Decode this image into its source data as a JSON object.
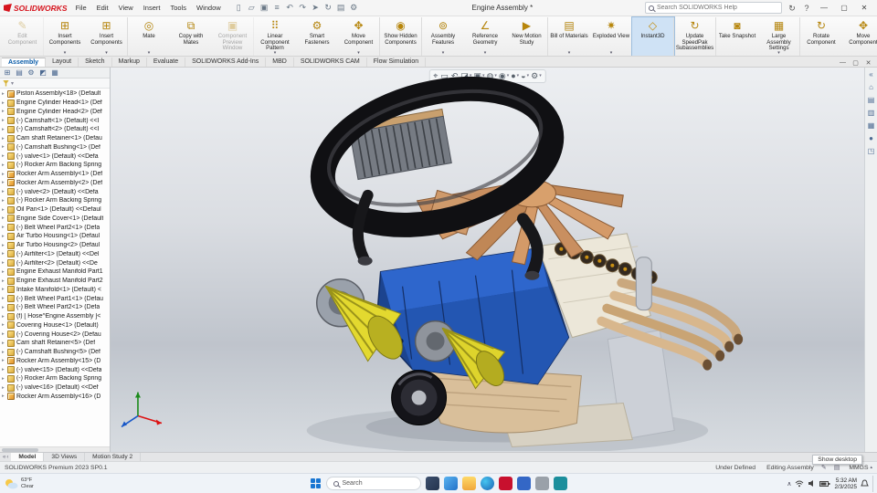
{
  "window": {
    "app_name": "SOLIDWORKS",
    "title": "Engine Assembly *",
    "search_placeholder": "Search SOLIDWORKS Help",
    "controls": {
      "minimize": "—",
      "maximize": "▢",
      "close": "✕"
    },
    "doc_controls": {
      "minimize": "—",
      "restore": "▢",
      "close": "✕"
    },
    "help_glyph": "?",
    "sync_glyph": "↻"
  },
  "menus": [
    "File",
    "Edit",
    "View",
    "Insert",
    "Tools",
    "Window"
  ],
  "qat": [
    {
      "name": "new-file-icon",
      "glyph": "▯"
    },
    {
      "name": "open-file-icon",
      "glyph": "▱"
    },
    {
      "name": "save-icon",
      "glyph": "▣"
    },
    {
      "name": "print-icon",
      "glyph": "≡"
    },
    {
      "name": "undo-icon",
      "glyph": "↶"
    },
    {
      "name": "redo-icon",
      "glyph": "↷"
    },
    {
      "name": "select-arrow-icon",
      "glyph": "➤"
    },
    {
      "name": "rebuild-icon",
      "glyph": "↻"
    },
    {
      "name": "file-properties-icon",
      "glyph": "▤"
    },
    {
      "name": "options-icon",
      "glyph": "⚙"
    }
  ],
  "ribbon": {
    "buttons": [
      {
        "label": "Edit Component",
        "glyph": "✎",
        "cls": "disabled sep"
      },
      {
        "label": "Insert Components",
        "glyph": "⊞",
        "dd": "▾"
      },
      {
        "label": "Insert Components",
        "glyph": "⊞",
        "dd": "▾",
        "cls": "sep"
      },
      {
        "label": "Mate",
        "glyph": "◎",
        "dd": "▾"
      },
      {
        "label": "Copy with Mates",
        "glyph": "⧉"
      },
      {
        "label": "Component Preview Window",
        "glyph": "▣",
        "cls": "disabled sep"
      },
      {
        "label": "Linear Component Pattern",
        "glyph": "⠿",
        "dd": "▾"
      },
      {
        "label": "Smart Fasteners",
        "glyph": "⚙"
      },
      {
        "label": "Move Component",
        "glyph": "✥",
        "dd": "▾",
        "cls": "sep"
      },
      {
        "label": "Show Hidden Components",
        "glyph": "◉",
        "cls": "sep"
      },
      {
        "label": "Assembly Features",
        "glyph": "⊚",
        "dd": "▾"
      },
      {
        "label": "Reference Geometry",
        "glyph": "∠",
        "dd": "▾"
      },
      {
        "label": "New Motion Study",
        "glyph": "▶",
        "cls": "sep"
      },
      {
        "label": "Bill of Materials",
        "glyph": "▤",
        "dd": "▾"
      },
      {
        "label": "Exploded View",
        "glyph": "✷",
        "dd": "▾"
      },
      {
        "label": "Instant3D",
        "glyph": "◇",
        "cls": "active sep"
      },
      {
        "label": "Update SpeedPak Subassemblies",
        "glyph": "↻",
        "cls": "sep"
      },
      {
        "label": "Take Snapshot",
        "glyph": "◙"
      },
      {
        "label": "Large Assembly Settings",
        "glyph": "▦",
        "dd": "▾",
        "cls": "sep"
      },
      {
        "label": "Rotate Component",
        "glyph": "↻"
      },
      {
        "label": "Move Component",
        "glyph": "✥"
      }
    ]
  },
  "command_tabs": [
    {
      "label": "Assembly",
      "cls": "active"
    },
    {
      "label": "Layout"
    },
    {
      "label": "Sketch"
    },
    {
      "label": "Markup"
    },
    {
      "label": "Evaluate"
    },
    {
      "label": "SOLIDWORKS Add-Ins"
    },
    {
      "label": "MBD"
    },
    {
      "label": "SOLIDWORKS CAM"
    },
    {
      "label": "Flow Simulation"
    }
  ],
  "panel_tabs": [
    {
      "name": "feature-manager-tab-icon",
      "glyph": "⊞"
    },
    {
      "name": "property-manager-tab-icon",
      "glyph": "▤"
    },
    {
      "name": "configuration-manager-tab-icon",
      "glyph": "⚙"
    },
    {
      "name": "display-manager-tab-icon",
      "glyph": "◩"
    },
    {
      "name": "cam-tree-tab-icon",
      "glyph": "▦"
    }
  ],
  "tree": {
    "expand_glyph": "▸",
    "items": [
      {
        "label": "Piston Assembly<18> (Default",
        "cls": "asm"
      },
      {
        "label": "Engine Cylinder Head<1> (Def",
        "cls": "part"
      },
      {
        "label": "Engine Cylinder Head<2> (Def",
        "cls": "part"
      },
      {
        "label": "(-) Camshaft<1> (Default) <<I",
        "cls": "part"
      },
      {
        "label": "(-) Camshaft<2> (Default) <<I",
        "cls": "part"
      },
      {
        "label": "Cam shaft Retainer<1> (Defau",
        "cls": "part"
      },
      {
        "label": "(-) Camshaft Bushing<1> (Def",
        "cls": "part"
      },
      {
        "label": "(-) valve<1> (Default) <<Defa",
        "cls": "part"
      },
      {
        "label": "(-) Rocker Arm Backing Spring",
        "cls": "part"
      },
      {
        "label": "Rocker Arm Assembly<1> (Def",
        "cls": "asm"
      },
      {
        "label": "Rocker Arm Assembly<2> (Def",
        "cls": "asm"
      },
      {
        "label": "(-) valve<2> (Default) <<Defa",
        "cls": "part"
      },
      {
        "label": "(-) Rocker Arm Backing Spring",
        "cls": "part"
      },
      {
        "label": "Oil Pan<1> (Default) <<Defaul",
        "cls": "part"
      },
      {
        "label": "Engine Side Cover<1> (Default",
        "cls": "part"
      },
      {
        "label": "(-) Belt Wheel Part2<1> (Defa",
        "cls": "part"
      },
      {
        "label": "Air Turbo Housing<1> (Defaul",
        "cls": "part"
      },
      {
        "label": "Air Turbo Housing<2> (Defaul",
        "cls": "part"
      },
      {
        "label": "(-) Airfilter<1> (Default) <<Del",
        "cls": "part"
      },
      {
        "label": "(-) Airfilter<2> (Default) <<De",
        "cls": "part"
      },
      {
        "label": "Engine Exhaust Manifold Part1",
        "cls": "part"
      },
      {
        "label": "Engine Exhaust Manifold Part2",
        "cls": "part"
      },
      {
        "label": "Intake Manifold<1> (Default) <",
        "cls": "part"
      },
      {
        "label": "(-) Belt Wheel Part1<1> (Defau",
        "cls": "part"
      },
      {
        "label": "(-) Belt Wheel Part2<1> (Defa",
        "cls": "part"
      },
      {
        "label": "(f) [ Hose^Engine Assembly ]<",
        "cls": "part"
      },
      {
        "label": "Covering House<1> (Default)",
        "cls": "part"
      },
      {
        "label": "(-) Covering House<2> (Defau",
        "cls": "part"
      },
      {
        "label": "Cam shaft Retainer<5> (Def",
        "cls": "part"
      },
      {
        "label": "(-) Camshaft Bushing<5> (Def",
        "cls": "part"
      },
      {
        "label": "Rocker Arm Assembly<15> (D",
        "cls": "asm"
      },
      {
        "label": "(-) valve<15> (Default) <<Defa",
        "cls": "part"
      },
      {
        "label": "(-) Rocker Arm Backing Spring",
        "cls": "part"
      },
      {
        "label": "(-) valve<16> (Default) <<Def",
        "cls": "part"
      },
      {
        "label": "Rocker Arm Assembly<16> (D",
        "cls": "asm"
      }
    ]
  },
  "hud": [
    {
      "name": "zoom-fit-icon",
      "glyph": "⌖"
    },
    {
      "name": "zoom-area-icon",
      "glyph": "▭"
    },
    {
      "name": "previous-view-icon",
      "glyph": "↶"
    },
    {
      "name": "section-view-icon",
      "glyph": "◪",
      "dd": "▾"
    },
    {
      "name": "view-orientation-icon",
      "glyph": "▣",
      "dd": "▾"
    },
    {
      "name": "display-style-icon",
      "glyph": "◍",
      "dd": "▾"
    },
    {
      "name": "hide-show-items-icon",
      "glyph": "◉",
      "dd": "▾"
    },
    {
      "name": "edit-appearance-icon",
      "glyph": "●",
      "dd": "▾"
    },
    {
      "name": "apply-scene-icon",
      "glyph": "◒",
      "dd": "▾"
    },
    {
      "name": "view-settings-icon",
      "glyph": "⚙",
      "dd": "▾"
    }
  ],
  "task_pane": [
    {
      "name": "collapse-pane-icon",
      "glyph": "«"
    },
    {
      "name": "solidworks-resources-icon",
      "glyph": "⌂"
    },
    {
      "name": "design-library-icon",
      "glyph": "▤"
    },
    {
      "name": "file-explorer-pane-icon",
      "glyph": "▥"
    },
    {
      "name": "view-palette-icon",
      "glyph": "▦"
    },
    {
      "name": "appearances-scenes-icon",
      "glyph": "●"
    },
    {
      "name": "custom-properties-icon",
      "glyph": "◳"
    }
  ],
  "bottom_tabs": {
    "nav_back": "«",
    "nav_fwd": "‹",
    "tabs": [
      {
        "label": "Model",
        "cls": "active"
      },
      {
        "label": "3D Views"
      },
      {
        "label": "Motion Study 2"
      }
    ]
  },
  "status": {
    "left": "SOLIDWORKS Premium 2023 SP0.1",
    "state": "Under Defined",
    "mode": "Editing Assembly",
    "pencil_glyph": "✎",
    "sheet_glyph": "▤",
    "units": "MMGS",
    "units_chev": "▴",
    "show_desktop": "Show desktop"
  },
  "taskbar": {
    "weather_temp": "63°F",
    "weather_desc": "Clear",
    "search_label": "Search",
    "apps": [
      {
        "name": "task-view-icon",
        "cls": "tk-taskview"
      },
      {
        "name": "widgets-icon",
        "cls": "tk-widgets"
      },
      {
        "name": "file-explorer-icon",
        "cls": "tk-folder"
      },
      {
        "name": "edge-icon",
        "cls": "tk-edge"
      },
      {
        "name": "solidworks-taskbar-icon",
        "cls": "tk-sw"
      },
      {
        "name": "app-icon-blue",
        "cls": "tk-blue"
      },
      {
        "name": "app-icon-gray",
        "cls": "tk-gray"
      },
      {
        "name": "app-icon-teal",
        "cls": "tk-teal"
      }
    ],
    "tray": {
      "chevron": "∧",
      "time": "5:32 AM",
      "date": "2/3/2025"
    }
  }
}
